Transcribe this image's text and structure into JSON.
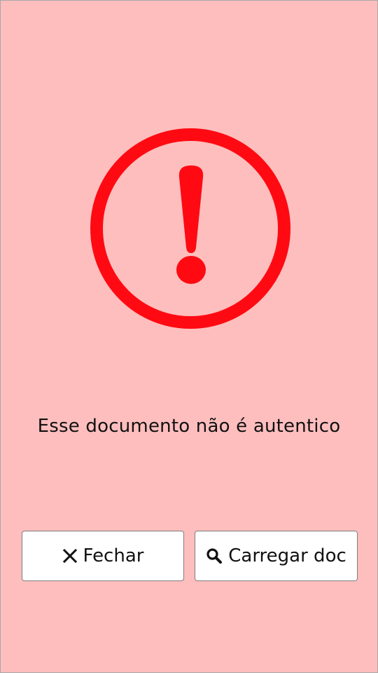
{
  "dialog": {
    "icon": "exclamation-circle-icon",
    "message": "Esse documento não é autentico",
    "accent_color": "#ff0a12",
    "background_color": "#ffbebe"
  },
  "buttons": {
    "close": {
      "label": "Fechar",
      "icon": "close-icon"
    },
    "load": {
      "label": "Carregar doc",
      "icon": "search-icon"
    }
  }
}
